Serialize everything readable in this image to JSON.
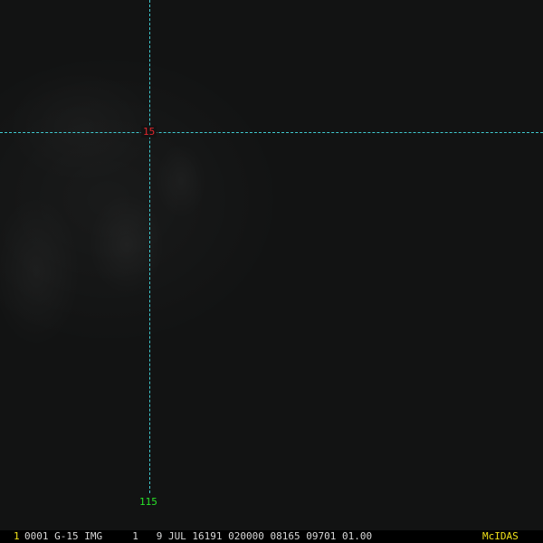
{
  "map": {
    "latitude_label": "15",
    "longitude_label": "115",
    "grid_color": "#3fc9cf",
    "latitude_label_color": "#e0262c",
    "longitude_label_color": "#28e128"
  },
  "status_bar": {
    "frame_number": "1",
    "header": "0001 G-15 IMG     1   9 JUL 16191 020000 08165 09701 01.00",
    "brand": "McIDAS",
    "highlight_color": "#f2e21a"
  }
}
